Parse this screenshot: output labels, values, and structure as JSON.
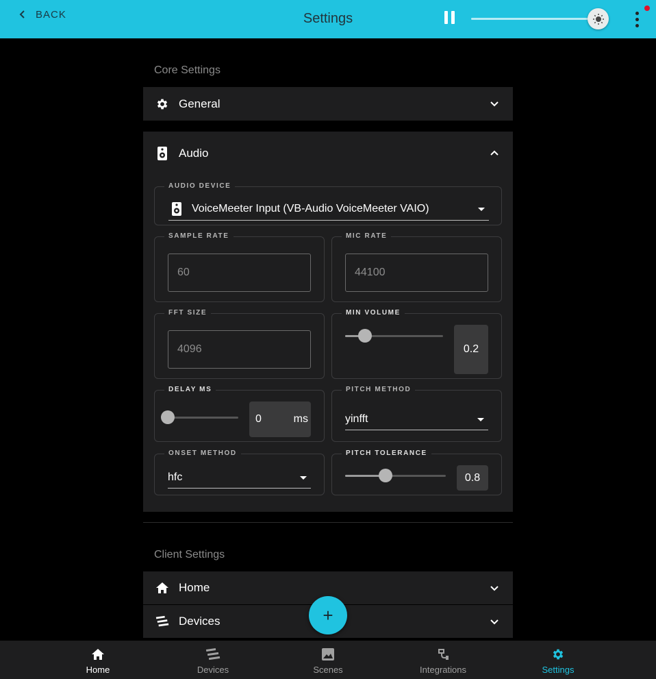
{
  "topbar": {
    "back_label": "BACK",
    "title": "Settings",
    "brightness_level": 0.92,
    "accent": "#20c3e0"
  },
  "core": {
    "section_title": "Core Settings",
    "general_label": "General",
    "audio_label": "Audio",
    "audio_device": {
      "legend": "AUDIO DEVICE",
      "value": "VoiceMeeter Input (VB-Audio VoiceMeeter VAIO)"
    },
    "sample_rate": {
      "legend": "SAMPLE RATE",
      "value": "60"
    },
    "mic_rate": {
      "legend": "MIC RATE",
      "value": "44100"
    },
    "fft_size": {
      "legend": "FFT SIZE",
      "value": "4096"
    },
    "min_volume": {
      "legend": "MIN VOLUME",
      "value": "0.2",
      "level": 0.2
    },
    "delay_ms": {
      "legend": "DELAY MS",
      "value": "0",
      "unit": "ms",
      "level": 0
    },
    "pitch_method": {
      "legend": "PITCH METHOD",
      "value": "yinfft"
    },
    "onset_method": {
      "legend": "ONSET METHOD",
      "value": "hfc"
    },
    "pitch_tolerance": {
      "legend": "PITCH TOLERANCE",
      "value": "0.8",
      "level": 0.4
    }
  },
  "client": {
    "section_title": "Client Settings",
    "home_label": "Home",
    "devices_label": "Devices"
  },
  "fab": {
    "label": "+"
  },
  "nav": {
    "items": [
      {
        "label": "Home",
        "icon": "home-icon"
      },
      {
        "label": "Devices",
        "icon": "devices-icon"
      },
      {
        "label": "Scenes",
        "icon": "image-icon"
      },
      {
        "label": "Integrations",
        "icon": "plug-icon"
      },
      {
        "label": "Settings",
        "icon": "gear-icon"
      }
    ],
    "active": "Settings"
  }
}
